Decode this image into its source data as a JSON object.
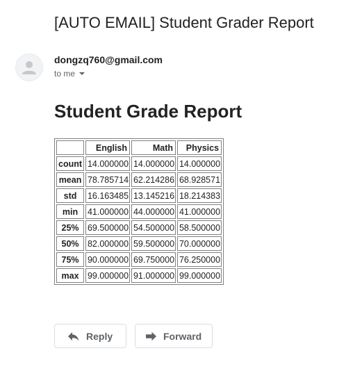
{
  "email": {
    "subject": "[AUTO EMAIL] Student Grader Report",
    "sender": "dongzq760@gmail.com",
    "recipient": "to me"
  },
  "report": {
    "title": "Student Grade Report",
    "table": {
      "columns": [
        "",
        "English",
        "Math",
        "Physics"
      ],
      "rows": [
        {
          "label": "count",
          "values": [
            "14.000000",
            "14.000000",
            "14.000000"
          ]
        },
        {
          "label": "mean",
          "values": [
            "78.785714",
            "62.214286",
            "68.928571"
          ]
        },
        {
          "label": "std",
          "values": [
            "16.163485",
            "13.145216",
            "18.214383"
          ]
        },
        {
          "label": "min",
          "values": [
            "41.000000",
            "44.000000",
            "41.000000"
          ]
        },
        {
          "label": "25%",
          "values": [
            "69.500000",
            "54.500000",
            "58.500000"
          ]
        },
        {
          "label": "50%",
          "values": [
            "82.000000",
            "59.500000",
            "70.000000"
          ]
        },
        {
          "label": "75%",
          "values": [
            "90.000000",
            "69.750000",
            "76.250000"
          ]
        },
        {
          "label": "max",
          "values": [
            "99.000000",
            "91.000000",
            "99.000000"
          ]
        }
      ]
    }
  },
  "actions": {
    "reply_label": "Reply",
    "forward_label": "Forward"
  },
  "icons": {
    "avatar": "person-icon",
    "reply": "reply-arrow-icon",
    "forward": "forward-arrow-icon",
    "recipient_menu": "caret-down-icon"
  },
  "colors": {
    "text_primary": "#202124",
    "text_secondary": "#5f6368",
    "border": "#dadce0",
    "avatar_bg": "#f1f3f4"
  }
}
